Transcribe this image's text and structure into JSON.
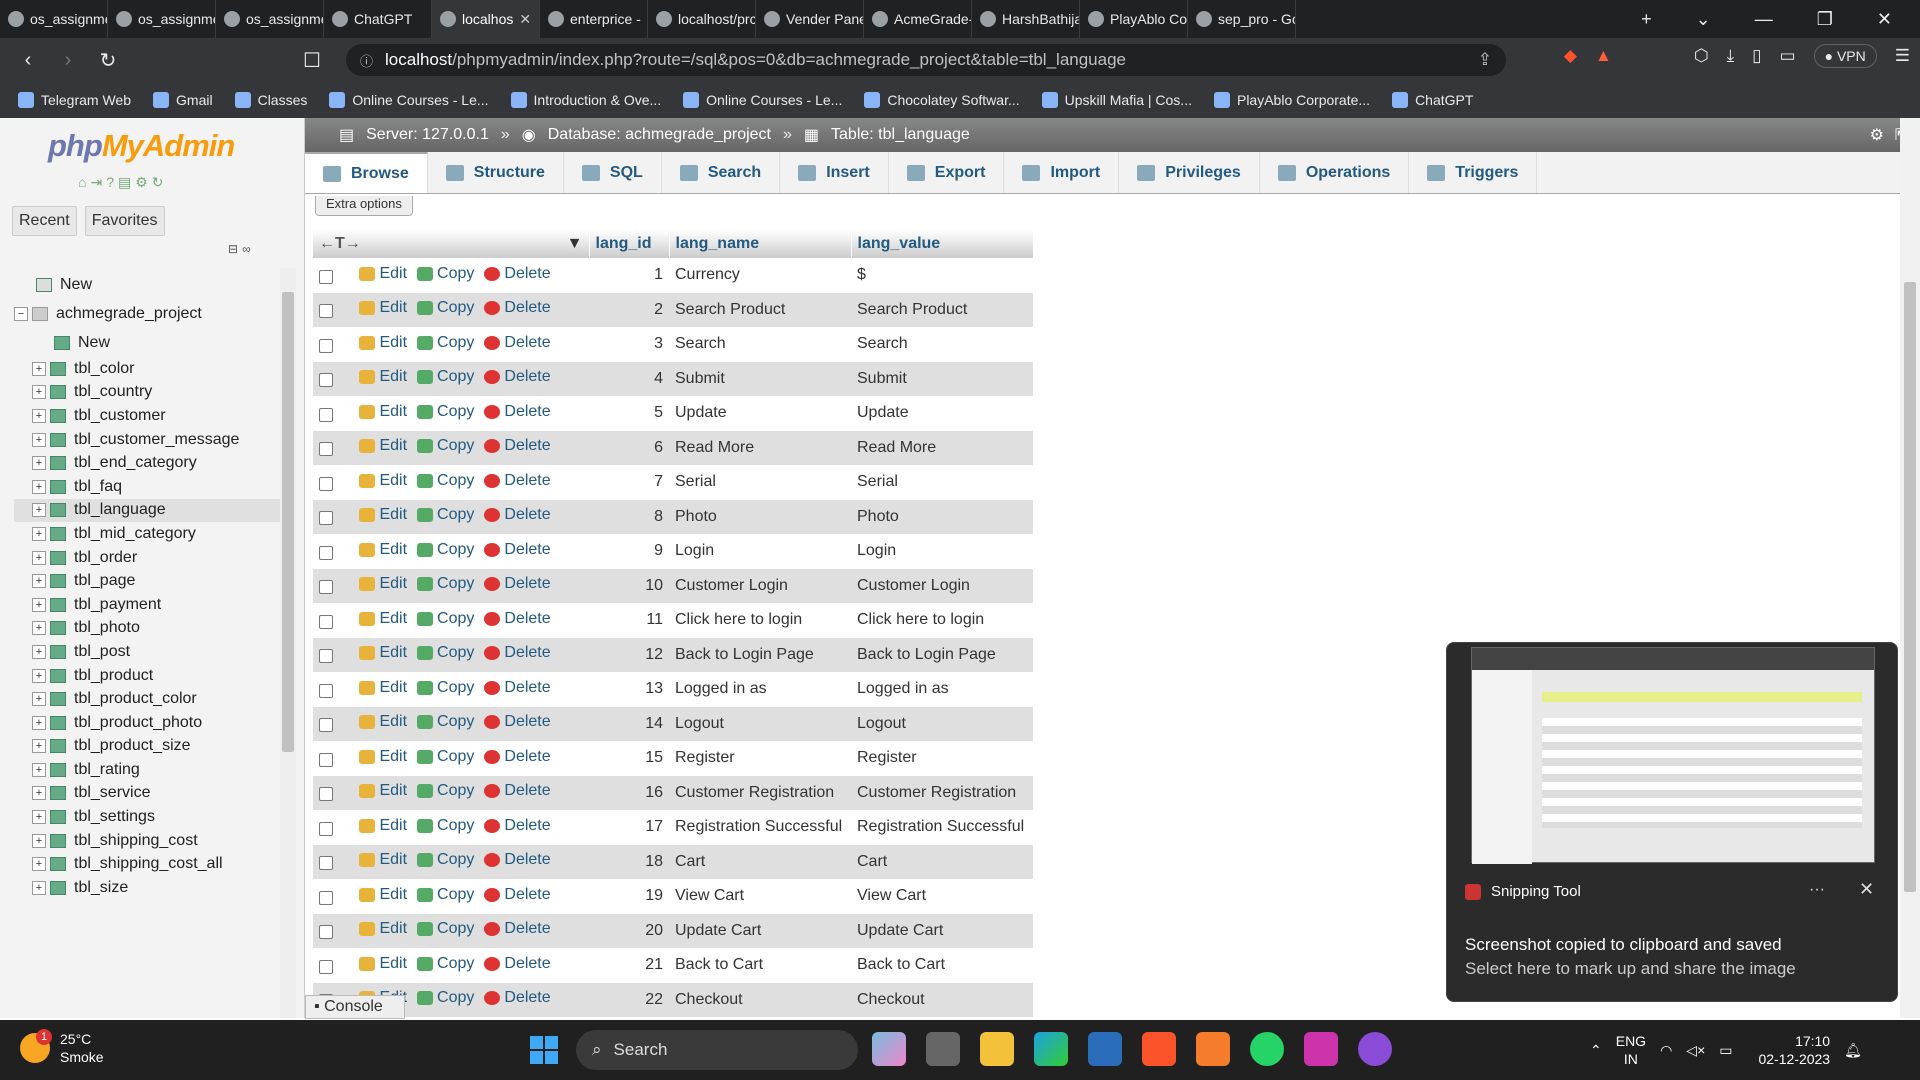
{
  "browser": {
    "tabs": [
      {
        "label": "os_assignme",
        "active": false,
        "icon": "globe-icon"
      },
      {
        "label": "os_assignme",
        "active": false,
        "icon": "globe-icon"
      },
      {
        "label": "os_assignme",
        "active": false,
        "icon": "globe-icon"
      },
      {
        "label": "ChatGPT",
        "active": false,
        "icon": "chatgpt-icon"
      },
      {
        "label": "localhos",
        "active": true,
        "icon": "phpmyadmin-icon"
      },
      {
        "label": "enterprice -",
        "active": false,
        "icon": "google-icon"
      },
      {
        "label": "localhost/prc",
        "active": false,
        "icon": "cart-icon"
      },
      {
        "label": "Vender Panel",
        "active": false,
        "icon": "xampp-icon"
      },
      {
        "label": "AcmeGrade-",
        "active": false,
        "icon": "github-icon"
      },
      {
        "label": "HarshBathija",
        "active": false,
        "icon": "github-icon"
      },
      {
        "label": "PlayAblo Cor",
        "active": false,
        "icon": "playablo-icon"
      },
      {
        "label": "sep_pro - Go",
        "active": false,
        "icon": "drive-icon"
      }
    ],
    "url_host": "localhost",
    "url_path": "/phpmyadmin/index.php?route=/sql&pos=0&db=achmegrade_project&table=tbl_language",
    "vpn_label": "VPN",
    "bookmarks": [
      "Telegram Web",
      "Gmail",
      "Classes",
      "Online Courses - Le...",
      "Introduction & Ove...",
      "Online Courses - Le...",
      "Chocolatey Softwar...",
      "Upskill Mafia | Cos...",
      "PlayAblo Corporate...",
      "ChatGPT"
    ]
  },
  "pma": {
    "logo_php": "php",
    "logo_my": "MyAdmin",
    "nav_tabs": [
      "Recent",
      "Favorites"
    ],
    "tree": {
      "new_label": "New",
      "db_name": "achmegrade_project",
      "db_new": "New",
      "tables": [
        "tbl_color",
        "tbl_country",
        "tbl_customer",
        "tbl_customer_message",
        "tbl_end_category",
        "tbl_faq",
        "tbl_language",
        "tbl_mid_category",
        "tbl_order",
        "tbl_page",
        "tbl_payment",
        "tbl_photo",
        "tbl_post",
        "tbl_product",
        "tbl_product_color",
        "tbl_product_photo",
        "tbl_product_size",
        "tbl_rating",
        "tbl_service",
        "tbl_settings",
        "tbl_shipping_cost",
        "tbl_shipping_cost_all",
        "tbl_size"
      ],
      "selected": "tbl_language"
    },
    "breadcrumb": {
      "server": "Server: 127.0.0.1",
      "database": "Database: achmegrade_project",
      "table": "Table: tbl_language",
      "sep": "»"
    },
    "menu_tabs": [
      "Browse",
      "Structure",
      "SQL",
      "Search",
      "Insert",
      "Export",
      "Import",
      "Privileges",
      "Operations",
      "Triggers"
    ],
    "active_tab": "Browse",
    "extra_options": "Extra options",
    "columns": [
      "lang_id",
      "lang_name",
      "lang_value"
    ],
    "row_actions": {
      "edit": "Edit",
      "copy": "Copy",
      "delete": "Delete"
    },
    "rows": [
      {
        "id": "1",
        "name": "Currency",
        "value": "$"
      },
      {
        "id": "2",
        "name": "Search Product",
        "value": "Search Product"
      },
      {
        "id": "3",
        "name": "Search",
        "value": "Search"
      },
      {
        "id": "4",
        "name": "Submit",
        "value": "Submit"
      },
      {
        "id": "5",
        "name": "Update",
        "value": "Update"
      },
      {
        "id": "6",
        "name": "Read More",
        "value": "Read More"
      },
      {
        "id": "7",
        "name": "Serial",
        "value": "Serial"
      },
      {
        "id": "8",
        "name": "Photo",
        "value": "Photo"
      },
      {
        "id": "9",
        "name": "Login",
        "value": "Login"
      },
      {
        "id": "10",
        "name": "Customer Login",
        "value": "Customer Login"
      },
      {
        "id": "11",
        "name": "Click here to login",
        "value": "Click here to login"
      },
      {
        "id": "12",
        "name": "Back to Login Page",
        "value": "Back to Login Page"
      },
      {
        "id": "13",
        "name": "Logged in as",
        "value": "Logged in as"
      },
      {
        "id": "14",
        "name": "Logout",
        "value": "Logout"
      },
      {
        "id": "15",
        "name": "Register",
        "value": "Register"
      },
      {
        "id": "16",
        "name": "Customer Registration",
        "value": "Customer Registration"
      },
      {
        "id": "17",
        "name": "Registration Successful",
        "value": "Registration Successful"
      },
      {
        "id": "18",
        "name": "Cart",
        "value": "Cart"
      },
      {
        "id": "19",
        "name": "View Cart",
        "value": "View Cart"
      },
      {
        "id": "20",
        "name": "Update Cart",
        "value": "Update Cart"
      },
      {
        "id": "21",
        "name": "Back to Cart",
        "value": "Back to Cart"
      },
      {
        "id": "22",
        "name": "Checkout",
        "value": "Checkout"
      }
    ],
    "console_label": "Console"
  },
  "snipping_tool": {
    "app_name": "Snipping Tool",
    "menu": "···",
    "close": "✕",
    "message": "Screenshot copied to clipboard and saved",
    "sub_message": "Select here to mark up and share the image"
  },
  "taskbar": {
    "weather_temp": "25°C",
    "weather_desc": "Smoke",
    "weather_badge": "1",
    "search_label": "Search",
    "lang_top": "ENG",
    "lang_bottom": "IN",
    "time": "17:10",
    "date": "02-12-2023"
  }
}
